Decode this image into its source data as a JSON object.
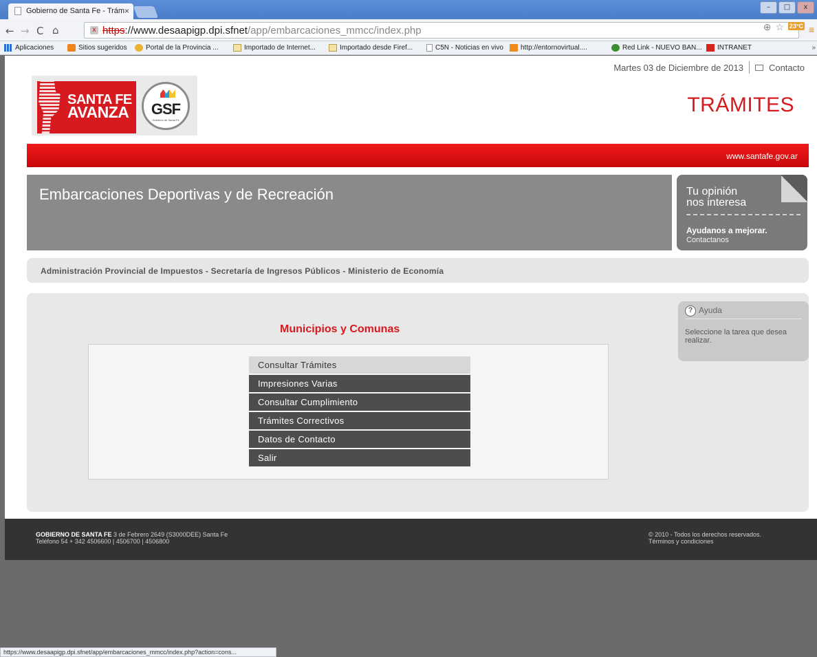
{
  "browser": {
    "tab_title": "Gobierno de Santa Fe - Trám",
    "url_scheme": "https",
    "url_host": "://www.desaapigp.dpi.sfnet",
    "url_path": "/app/embarcaciones_mmcc/index.php",
    "weather_badge": "23°C",
    "status_url": "https://www.desaapigp.dpi.sfnet/app/embarcaciones_mmcc/index.php?action=cons...",
    "bookmarks": [
      {
        "label": "Aplicaciones",
        "icon": "apps-icon"
      },
      {
        "label": "Sitios sugeridos",
        "icon": "orange-bookmark-icon"
      },
      {
        "label": "Portal de la Provincia ...",
        "icon": "star-bookmark-icon"
      },
      {
        "label": "Importado de Internet...",
        "icon": "folder-icon"
      },
      {
        "label": "Importado desde Firef...",
        "icon": "folder-icon"
      },
      {
        "label": "C5N - Noticias en vivo",
        "icon": "page-icon"
      },
      {
        "label": "http://entornovirtual....",
        "icon": "moodle-icon"
      },
      {
        "label": "Red Link - NUEVO BAN...",
        "icon": "green-bookmark-icon"
      },
      {
        "label": "INTRANET",
        "icon": "red-bookmark-icon"
      }
    ],
    "bookmarks_more": "»"
  },
  "header": {
    "date": "Martes 03 de Diciembre de 2013",
    "contact_link": "Contacto",
    "logo_text_line1": "SANTA FE",
    "logo_text_line2": "AVANZA",
    "gsf_text": "GSF",
    "gsf_subtext": "Gobierno de Santa Fe",
    "section_title": "TRÁMITES",
    "site_url": "www.santafe.gov.ar"
  },
  "banner": {
    "title": "Embarcaciones Deportivas y de Recreación"
  },
  "opinion": {
    "line1": "Tu opinión",
    "line2": "nos interesa",
    "cta": "Ayudanos a mejorar.",
    "link": "Contactanos"
  },
  "ministry": "Administración Provincial de Impuestos - Secretaría de Ingresos Públicos - Ministerio de Economía",
  "main": {
    "title": "Municipios y Comunas",
    "menu": [
      {
        "label": "Consultar Trámites",
        "active": true
      },
      {
        "label": "Impresiones Varias",
        "active": false
      },
      {
        "label": "Consultar Cumplimiento",
        "active": false
      },
      {
        "label": "Trámites Correctivos",
        "active": false
      },
      {
        "label": "Datos de Contacto",
        "active": false
      },
      {
        "label": "Salir",
        "active": false
      }
    ]
  },
  "help": {
    "title": "Ayuda",
    "text": "Seleccione la tarea que desea realizar."
  },
  "footer": {
    "org": "GOBIERNO DE SANTA FE",
    "address": " 3 de Febrero 2649 (S3000DEE) Santa Fe",
    "phone": "Teléfono 54 + 342 4506600 | 4506700 | 4506800",
    "copyright": "© 2010 - Todos los derechos reservados.",
    "terms": "Términos y condiciones"
  },
  "colors": {
    "brand_red": "#d71920",
    "menu_dark": "#4d4d4d",
    "banner_gray": "#8a8a8a",
    "footer_dark": "#333333"
  }
}
